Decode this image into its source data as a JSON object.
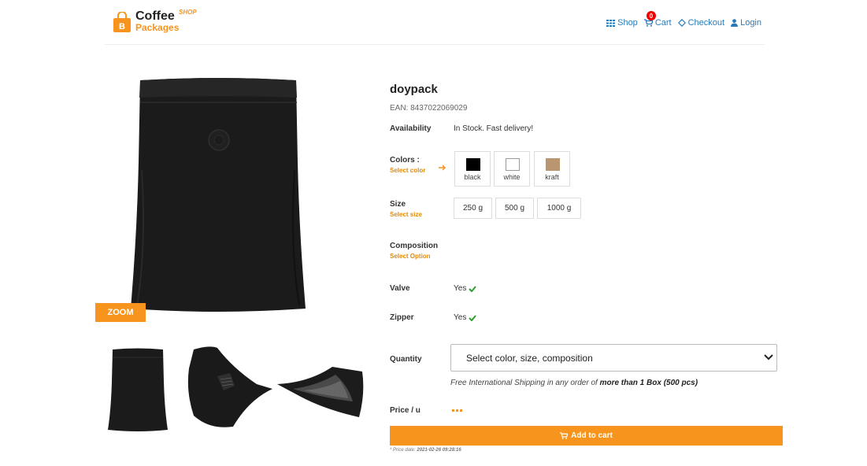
{
  "header": {
    "logo_coffee": "Coffee",
    "logo_shop": "SHOP",
    "logo_packages": "Packages",
    "nav": {
      "shop": "Shop",
      "cart": "Cart",
      "cart_count": "0",
      "checkout": "Checkout",
      "login": "Login"
    }
  },
  "gallery": {
    "zoom_label": "ZOOM"
  },
  "product": {
    "title": "doypack",
    "ean": "EAN: 8437022069029",
    "availability_label": "Availability",
    "availability_value": "In Stock. Fast delivery!",
    "colors_label": "Colors :",
    "colors_hint": "Select color",
    "colors": [
      {
        "name": "black",
        "hex": "#000000"
      },
      {
        "name": "white",
        "hex": "#ffffff"
      },
      {
        "name": "kraft",
        "hex": "#b99670"
      }
    ],
    "size_label": "Size",
    "size_hint": "Select size",
    "sizes": [
      "250 g",
      "500 g",
      "1000 g"
    ],
    "composition_label": "Composition",
    "composition_hint": "Select Option",
    "valve_label": "Valve",
    "valve_value": "Yes",
    "zipper_label": "Zipper",
    "zipper_value": "Yes",
    "quantity_label": "Quantity",
    "quantity_selected": "Select color, size, composition",
    "shipping_prefix": "Free International Shipping in any order of ",
    "shipping_bold": "more than 1 Box (500 pcs)",
    "price_label": "Price / u",
    "add_to_cart": "Add to cart",
    "price_date_prefix": "* Price date: ",
    "price_date_value": "2021-02-26 09:28:16"
  },
  "colors": {
    "accent": "#f7941d",
    "link": "#2a7ab8",
    "check": "#2e9e2e"
  }
}
